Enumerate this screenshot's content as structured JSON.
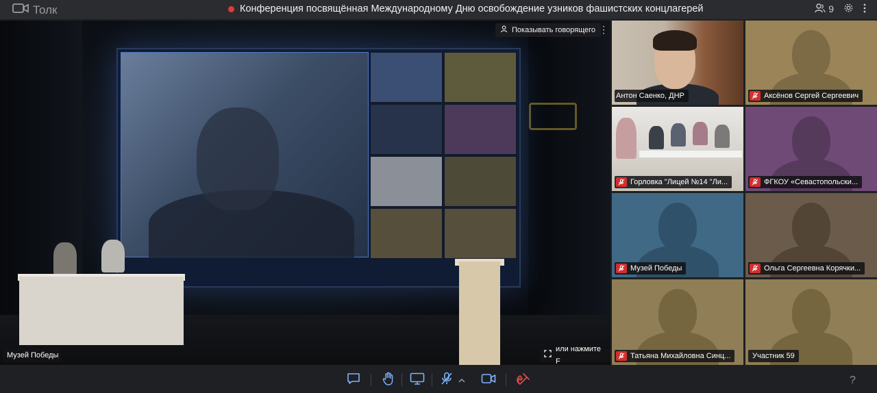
{
  "app": {
    "name": "Толк"
  },
  "header": {
    "title": "Конференция посвящённая Международному Дню освобождение узников фашистских концлагерей",
    "participants_count": "9"
  },
  "main_video": {
    "speaker_toggle_label": "Показывать говорящего",
    "participant_name": "Музей Победы",
    "fullscreen_hint": "или нажмите F"
  },
  "participants": [
    {
      "name": "Антон Саенко, ДНР",
      "camera": true,
      "muted": false,
      "active": true,
      "color": "#2f8fff"
    },
    {
      "name": "Аксёнов Сергей Сергеевич",
      "camera": false,
      "muted": true,
      "color": "#9a8458"
    },
    {
      "name": "Горловка \"Лицей №14 \"Ли...",
      "camera": true,
      "muted": true
    },
    {
      "name": "ФГКОУ «Севастопольски...",
      "camera": false,
      "muted": true,
      "color": "#6f4a76"
    },
    {
      "name": "Музей Победы",
      "camera": false,
      "muted": true,
      "color": "#3f6985"
    },
    {
      "name": "Ольга Сергеевна Корячки...",
      "camera": false,
      "muted": true,
      "color": "#6a5b4a"
    },
    {
      "name": "Татьяна Михайловна Синц...",
      "camera": false,
      "muted": true,
      "color": "#8f7e56"
    },
    {
      "name": "Участник 59",
      "camera": false,
      "muted": false,
      "color": "#8f7e56"
    }
  ],
  "toolbar": {
    "help": "?"
  },
  "colors": {
    "active_border": "#2f8fff",
    "mic_off": "#d32f2f",
    "hangup": "#e04b4b",
    "recording": "#e53935"
  }
}
